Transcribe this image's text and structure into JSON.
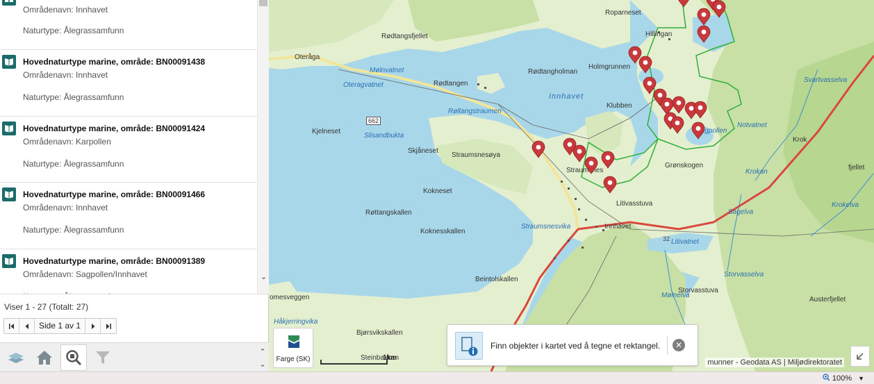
{
  "results": [
    {
      "title": "",
      "area": "Områdenavn: Innhavet",
      "type": "Naturtype: Ålegrassamfunn"
    },
    {
      "title": "Hovednaturtype marine, område: BN00091438",
      "area": "Områdenavn: Innhavet",
      "type": "Naturtype: Ålegrassamfunn"
    },
    {
      "title": "Hovednaturtype marine, område: BN00091424",
      "area": "Områdenavn: Karpollen",
      "type": "Naturtype: Ålegrassamfunn"
    },
    {
      "title": "Hovednaturtype marine, område: BN00091466",
      "area": "Områdenavn: Innhavet",
      "type": "Naturtype: Ålegrassamfunn"
    },
    {
      "title": "Hovednaturtype marine, område: BN00091389",
      "area": "Områdenavn: Sagpollen/Innhavet",
      "type": "Naturtype: Ålegrassamfunn"
    }
  ],
  "pager": {
    "count_text": "Viser 1 - 27 (Totalt: 27)",
    "page_label": "Side 1 av 1"
  },
  "toolbar": {
    "icons": [
      "layers-icon",
      "home-icon",
      "search-map-icon",
      "filter-icon"
    ]
  },
  "map": {
    "labels": {
      "oteraga": "Oteråga",
      "rodtangsfjellet": "Rødtangsfjellet",
      "molnvatnet": "Mølnvatnet",
      "oteragvatnet": "Oteragvatnet",
      "rodtangen": "Rødtangen",
      "rodtangholman": "Rødtangholman",
      "innhavet_water": "Innhavet",
      "holmgrunnen": "Holmgrunnen",
      "hillingan": "Hillingan",
      "roparneset": "Roparneset",
      "klubben": "Klubben",
      "kjelneset": "Kjelneset",
      "slisandbukta": "Slisandbukta",
      "skjaneset": "Skjåneset",
      "straumsnesoya": "Straumsnesøya",
      "straumsnes": "Straumsnes",
      "kokneset": "Kokneset",
      "rottangskallen": "Røttangskallen",
      "koknesskallen": "Koknesskallen",
      "straumsnesvika": "Straumsnesvika",
      "innhavet_town": "Innhavet",
      "litivasstuva": "Litivasstuva",
      "gronskogen": "Grønskogen",
      "notvatnet": "Notvatnet",
      "krok": "Krok",
      "fjellet": "fjellet",
      "krokan": "Krokan",
      "sagpollen": "Sagpollen",
      "litivatnet": "Litivatnet",
      "beintolskallen": "Beintolskallen",
      "omesveggen": "omesveggen",
      "hakjerringvika": "Håkjerringvika",
      "bjorsvikskallen": "Bjørsvikskallen",
      "steinbakkan": "Steinbakkan",
      "storvasstuva": "Storvasstuva",
      "austerfjellet": "Austerfjellet",
      "svartvasselva": "Svartvasselva",
      "sagelva": "Sagelva",
      "krokelva": "Krokelva",
      "storvasselva": "Storvasselva",
      "molnelva": "Mølnelva",
      "roltangstraumen": "Røltangstraumen",
      "road662": "662",
      "road32": "32"
    },
    "basemap_label": "Farge (SK)",
    "scale_label": "1km",
    "hint_text": "Finn objekter i kartet ved å tegne et rektangel.",
    "attribution": "munner - Geodata AS | Miljødirektoratet",
    "colors": {
      "water": "#a9d7ea",
      "land": "#e4efcf",
      "forest": "#c8e0a5",
      "marker": "#c9383a",
      "boundary": "#2fae3a"
    }
  },
  "status": {
    "zoom": "100%"
  }
}
